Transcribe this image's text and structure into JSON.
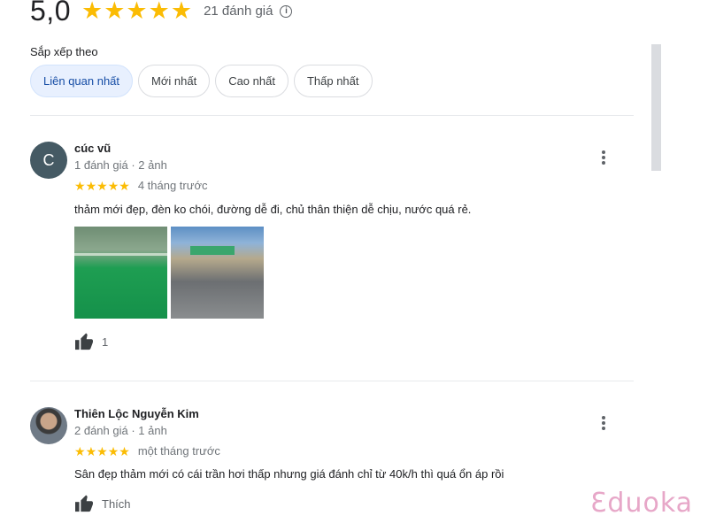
{
  "summary": {
    "rating": "5,0",
    "stars": 5,
    "review_count": "21 đánh giá"
  },
  "sort": {
    "label": "Sắp xếp theo",
    "options": [
      {
        "label": "Liên quan nhất",
        "selected": true
      },
      {
        "label": "Mới nhất",
        "selected": false
      },
      {
        "label": "Cao nhất",
        "selected": false
      },
      {
        "label": "Thấp nhất",
        "selected": false
      }
    ]
  },
  "reviews": [
    {
      "avatar_initial": "C",
      "name": "cúc vũ",
      "meta": "1 đánh giá · 2 ảnh",
      "stars": 5,
      "time": "4 tháng trước",
      "text": "thảm mới đẹp, đèn ko chói, đường dễ đi, chủ thân thiện dễ chịu, nước quá rẻ.",
      "photos": [
        "badminton-court-photo",
        "storefront-photo"
      ],
      "like_label": "1"
    },
    {
      "avatar_initial": "",
      "name": "Thiên Lộc Nguyễn Kim",
      "meta": "2 đánh giá · 1 ảnh",
      "stars": 5,
      "time": "một tháng trước",
      "text": "Sân đẹp thảm mới có cái trần hơi thấp nhưng giá đánh chỉ từ 40k/h thì quá ổn áp rồi",
      "photos": [],
      "like_label": "Thích"
    }
  ],
  "watermark": "Ɛduoka",
  "colors": {
    "star": "#fbbc04",
    "chip_active_bg": "#e8f0fe",
    "chip_active_text": "#174ea6",
    "avatar_bg": "#455a64",
    "watermark": "#e7a7c8"
  },
  "icons": [
    "star-icon",
    "info-icon",
    "more-options-icon",
    "thumbs-up-icon"
  ]
}
